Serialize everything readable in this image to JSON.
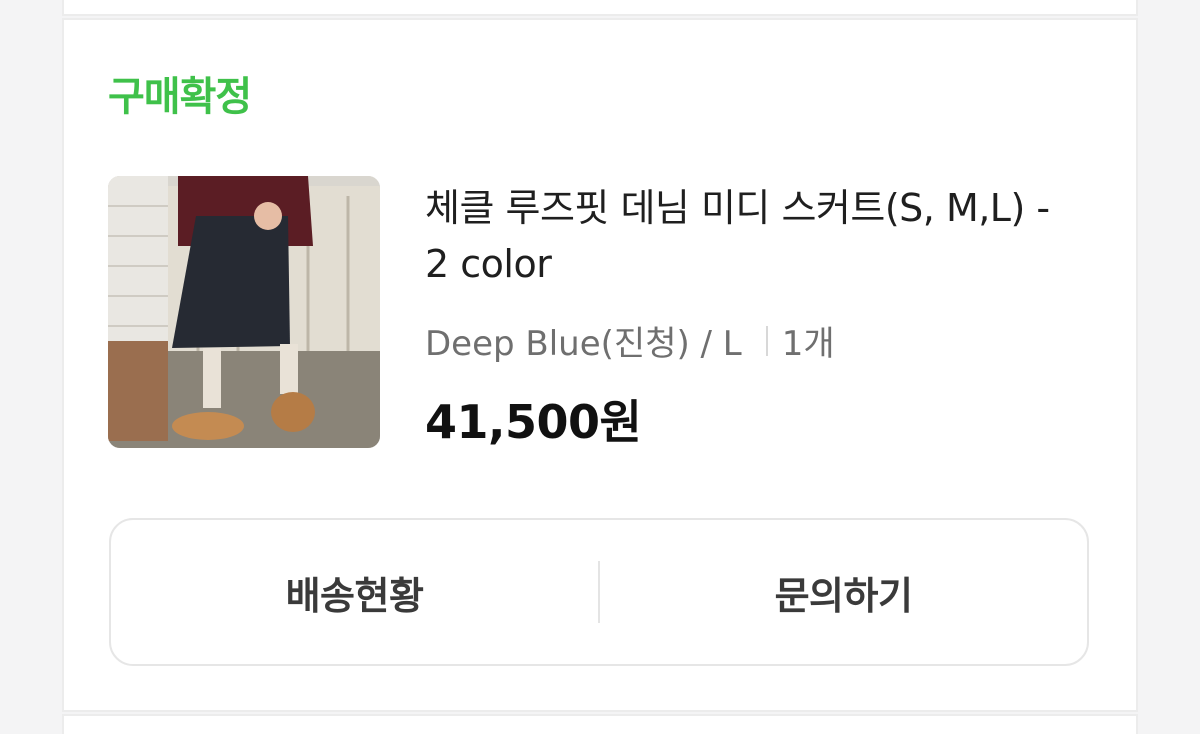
{
  "order": {
    "status": "구매확정",
    "status_color": "#3fc14a",
    "product": {
      "title": "체클 루즈핏 데님 미디 스커트(S, M,L) - 2 color",
      "option": "Deep Blue(진청) / L",
      "quantity": "1개",
      "price": "41,500원",
      "image_icon": "product-photo-skirt"
    },
    "actions": {
      "shipping_label": "배송현황",
      "inquiry_label": "문의하기"
    }
  }
}
